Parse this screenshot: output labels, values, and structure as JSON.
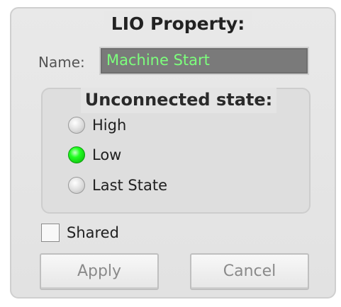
{
  "panel": {
    "title": "LIO Property:"
  },
  "name": {
    "label": "Name:",
    "value": "Machine Start"
  },
  "unconnected": {
    "title": "Unconnected state:",
    "options": [
      {
        "label": "High",
        "selected": false
      },
      {
        "label": "Low",
        "selected": true
      },
      {
        "label": "Last State",
        "selected": false
      }
    ]
  },
  "shared": {
    "label": "Shared",
    "checked": false
  },
  "buttons": {
    "apply": "Apply",
    "cancel": "Cancel"
  },
  "colors": {
    "name_text": "#7dff7d",
    "radio_selected": "#22ff22"
  }
}
